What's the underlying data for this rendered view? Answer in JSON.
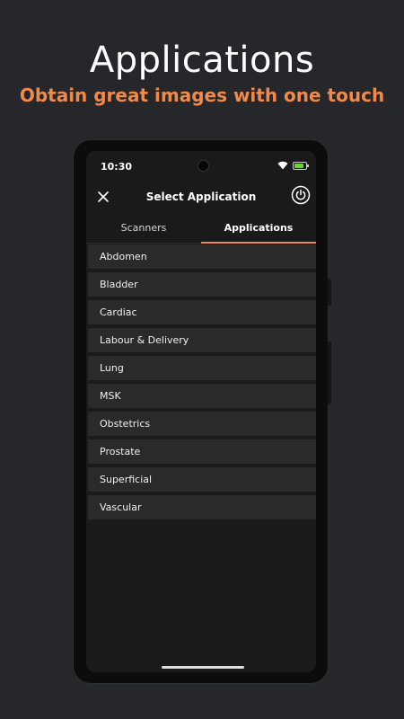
{
  "header": {
    "title": "Applications",
    "subtitle": "Obtain great images with one touch"
  },
  "status_bar": {
    "time": "10:30",
    "icons": [
      "wifi-icon",
      "battery-icon"
    ],
    "battery_color": "#6ccf3d"
  },
  "app_bar": {
    "title": "Select Application",
    "close_icon": "close-icon",
    "power_icon": "power-icon"
  },
  "tabs": [
    {
      "label": "Scanners",
      "active": false
    },
    {
      "label": "Applications",
      "active": true
    }
  ],
  "applications": [
    "Abdomen",
    "Bladder",
    "Cardiac",
    "Labour & Delivery",
    "Lung",
    "MSK",
    "Obstetrics",
    "Prostate",
    "Superficial",
    "Vascular"
  ],
  "colors": {
    "accent": "#f08a4b",
    "background": "#25272b",
    "screen": "#1a1a1a",
    "list_item": "#2a2a2a"
  }
}
